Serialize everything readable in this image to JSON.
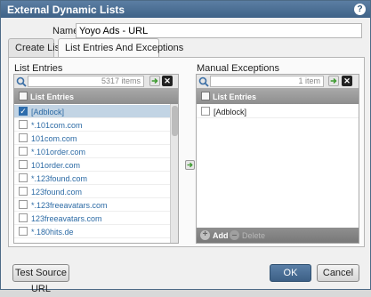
{
  "dialog": {
    "title": "External Dynamic Lists",
    "help_glyph": "?"
  },
  "name": {
    "label": "Name",
    "value": "Yoyo Ads - URL"
  },
  "tabs": [
    {
      "label": "Create List"
    },
    {
      "label": "List Entries And Exceptions"
    }
  ],
  "list_entries": {
    "section_label": "List Entries",
    "search_count": "5317 items",
    "column_header": "List Entries",
    "rows": [
      {
        "text": "[Adblock]",
        "checked": true
      },
      {
        "text": "*.101com.com",
        "checked": false
      },
      {
        "text": "101com.com",
        "checked": false
      },
      {
        "text": "*.101order.com",
        "checked": false
      },
      {
        "text": "101order.com",
        "checked": false
      },
      {
        "text": "*.123found.com",
        "checked": false
      },
      {
        "text": "123found.com",
        "checked": false
      },
      {
        "text": "*.123freeavatars.com",
        "checked": false
      },
      {
        "text": "123freeavatars.com",
        "checked": false
      },
      {
        "text": "*.180hits.de",
        "checked": false
      }
    ]
  },
  "manual_exceptions": {
    "section_label": "Manual Exceptions",
    "search_count": "1 item",
    "column_header": "List Entries",
    "rows": [
      {
        "text": "[Adblock]",
        "checked": false
      }
    ],
    "add_label": "Add",
    "delete_label": "Delete"
  },
  "buttons": {
    "test_source": "Test Source URL",
    "ok": "OK",
    "cancel": "Cancel"
  },
  "icons": {
    "search": "search-icon",
    "go": "arrow-right-icon",
    "clear": "close-icon",
    "move": "arrow-right-icon",
    "add": "plus-icon",
    "delete": "minus-icon"
  },
  "colors": {
    "accent": "#3f6287",
    "link": "#2d6ba5",
    "selected_row": "#c2d4e4",
    "go_arrow": "#3c9a2e"
  }
}
